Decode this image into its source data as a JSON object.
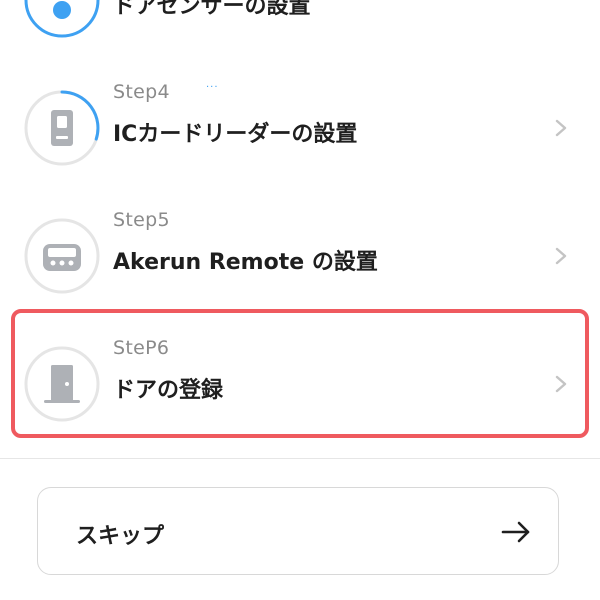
{
  "steps": [
    {
      "title": "ドアセンサーの設置",
      "icon": "door-sensor-icon"
    },
    {
      "label": "Step4",
      "title": "ICカードリーダーの設置",
      "icon": "card-reader-icon",
      "progress_text": "···",
      "progress_shown": 0.35
    },
    {
      "label": "Step5",
      "title": "Akerun Remote の設置",
      "icon": "remote-device-icon"
    },
    {
      "label": "SteP6",
      "title": "ドアの登録",
      "icon": "door-icon"
    }
  ],
  "skip": {
    "label": "スキップ"
  },
  "colors": {
    "accent_blue": "#3ea1f2",
    "highlight_red": "#ef5a5f",
    "ring_gray": "#e5e5e5",
    "icon_gray": "#aeb1b6",
    "label_gray": "#8a8a8a",
    "title_black": "#1f1f1f"
  }
}
